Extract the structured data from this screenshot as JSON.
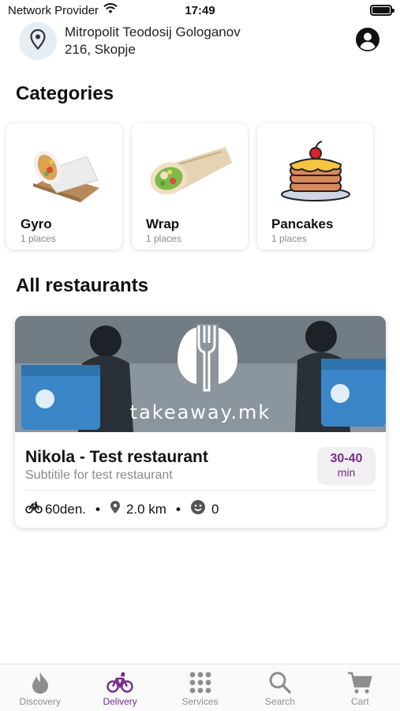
{
  "status_bar": {
    "carrier": "Network Provider",
    "time": "17:49"
  },
  "header": {
    "address_line1": "Mitropolit Teodosij Gologanov",
    "address_line2": "216, Skopje"
  },
  "categories_title": "Categories",
  "categories": [
    {
      "name": "Gyro",
      "count": "1 places",
      "icon": "gyro-image"
    },
    {
      "name": "Wrap",
      "count": "1 places",
      "icon": "wrap-image"
    },
    {
      "name": "Pancakes",
      "count": "1 places",
      "icon": "pancakes-image"
    }
  ],
  "restaurants_title": "All restaurants",
  "restaurant": {
    "banner_text": "takeaway.mk",
    "name": "Nikola - Test restaurant",
    "subtitle": "Subtitile for test restaurant",
    "eta_range": "30-40",
    "eta_unit": "min",
    "delivery_fee": "60den.",
    "distance": "2.0 km",
    "rating": "0"
  },
  "tabs": [
    {
      "label": "Discovery",
      "icon": "flame-icon",
      "active": false
    },
    {
      "label": "Delivery",
      "icon": "bicycle-icon",
      "active": true
    },
    {
      "label": "Services",
      "icon": "grid-icon",
      "active": false
    },
    {
      "label": "Search",
      "icon": "search-icon",
      "active": false
    },
    {
      "label": "Cart",
      "icon": "cart-icon",
      "active": false
    }
  ],
  "colors": {
    "accent": "#7a2b8c",
    "inactive": "#8e8e8e",
    "pin_bg": "#e6eef5"
  }
}
